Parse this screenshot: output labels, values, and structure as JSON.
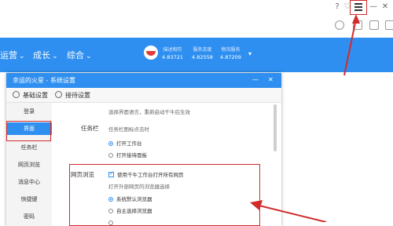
{
  "top_nav": {
    "items": [
      "运营",
      "成长",
      "综合"
    ],
    "stats": [
      {
        "label": "描述相符",
        "value": "4.83721"
      },
      {
        "label": "服务态度",
        "value": "4.82558"
      },
      {
        "label": "物流服务",
        "value": "4.87209"
      }
    ]
  },
  "dialog": {
    "title": "幸运的火星 - 系统设置",
    "tabs": [
      "基础设置",
      "接待设置"
    ],
    "sidebar": [
      "登录",
      "界面",
      "任务栏",
      "网页浏览",
      "消息中心",
      "快捷键",
      "密码"
    ],
    "active_sidebar": "界面",
    "content": {
      "lang_hint": "选择界面语言，重新启动千牛后生效",
      "taskbar_label": "任务栏",
      "taskbar_hint": "任务栏图标点击时",
      "taskbar_options": [
        "打开工作台",
        "打开接待面板"
      ],
      "browser_label": "网页浏览",
      "browser_checkbox": "使用千牛工作台打开所有网页",
      "browser_hint": "打开外部网页的浏览器选择",
      "browser_options": [
        "系统默认浏览器",
        "自主选择浏览器"
      ]
    }
  },
  "colors": {
    "accent": "#2f8ff0",
    "highlight": "#d12b2b"
  }
}
